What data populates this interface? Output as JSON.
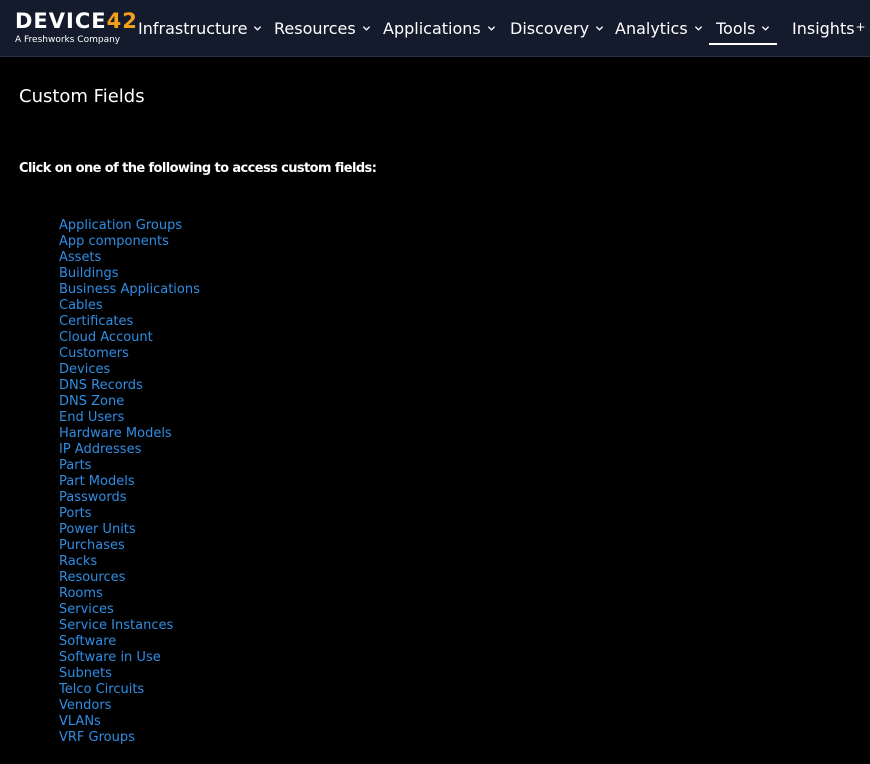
{
  "app": {
    "logo_text": "DEVICE",
    "logo_number": "42",
    "logo_subtitle": "A Freshworks Company"
  },
  "nav": {
    "items": [
      {
        "label": "Infrastructure",
        "has_dropdown": true
      },
      {
        "label": "Resources",
        "has_dropdown": true
      },
      {
        "label": "Applications",
        "has_dropdown": true
      },
      {
        "label": "Discovery",
        "has_dropdown": true
      },
      {
        "label": "Analytics",
        "has_dropdown": true
      },
      {
        "label": "Tools",
        "has_dropdown": true,
        "active": true
      },
      {
        "label": "Insights",
        "suffix": "+",
        "has_dropdown": false
      }
    ]
  },
  "main": {
    "title": "Custom Fields",
    "instructions": "Click on one of the following to access custom fields:",
    "links": [
      "Application Groups",
      "App components",
      "Assets",
      "Buildings",
      "Business Applications",
      "Cables",
      "Certificates",
      "Cloud Account",
      "Customers",
      "Devices",
      "DNS Records",
      "DNS Zone",
      "End Users",
      "Hardware Models",
      "IP Addresses",
      "Parts",
      "Part Models",
      "Passwords",
      "Ports",
      "Power Units",
      "Purchases",
      "Racks",
      "Resources",
      "Rooms",
      "Services",
      "Service Instances",
      "Software",
      "Software in Use",
      "Subnets",
      "Telco Circuits",
      "Vendors",
      "VLANs",
      "VRF Groups"
    ]
  },
  "colors": {
    "topbar_bg": "#131b2c",
    "page_bg": "#000000",
    "link": "#2f8de4",
    "logo_accent": "#f5a01a"
  }
}
